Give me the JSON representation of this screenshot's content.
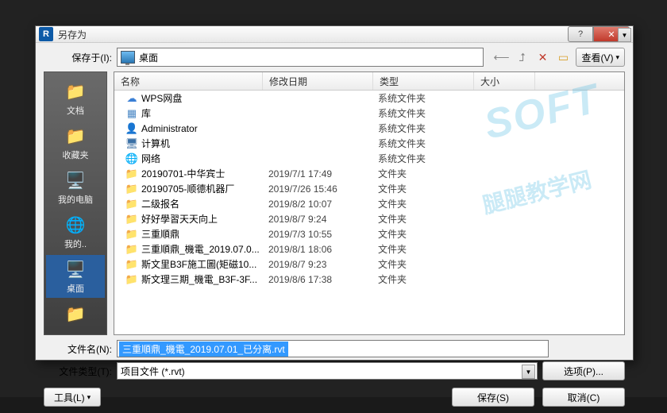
{
  "dialog": {
    "title": "另存为",
    "app_icon": "R"
  },
  "location": {
    "label": "保存于(I):",
    "value": "桌面",
    "view_btn": "查看(V)"
  },
  "sidebar": {
    "items": [
      {
        "label": "文档"
      },
      {
        "label": "收藏夹"
      },
      {
        "label": "我的电脑"
      },
      {
        "label": "我的.."
      },
      {
        "label": "桌面"
      },
      {
        "label": ""
      }
    ]
  },
  "columns": {
    "name": "名称",
    "date": "修改日期",
    "type": "类型",
    "size": "大小"
  },
  "rows": [
    {
      "icon": "cloud",
      "name": "WPS网盘",
      "date": "",
      "type": "系统文件夹"
    },
    {
      "icon": "lib",
      "name": "库",
      "date": "",
      "type": "系统文件夹"
    },
    {
      "icon": "user",
      "name": "Administrator",
      "date": "",
      "type": "系统文件夹"
    },
    {
      "icon": "pc",
      "name": "计算机",
      "date": "",
      "type": "系统文件夹"
    },
    {
      "icon": "net",
      "name": "网络",
      "date": "",
      "type": "系统文件夹"
    },
    {
      "icon": "folder",
      "name": "20190701-中华宾士",
      "date": "2019/7/1 17:49",
      "type": "文件夹"
    },
    {
      "icon": "folder",
      "name": "20190705-顺德机器厂",
      "date": "2019/7/26 15:46",
      "type": "文件夹"
    },
    {
      "icon": "folder",
      "name": "二级报名",
      "date": "2019/8/2 10:07",
      "type": "文件夹"
    },
    {
      "icon": "folder",
      "name": "好好學習天天向上",
      "date": "2019/8/7 9:24",
      "type": "文件夹"
    },
    {
      "icon": "folder",
      "name": "三重順鼎",
      "date": "2019/7/3 10:55",
      "type": "文件夹"
    },
    {
      "icon": "folder",
      "name": "三重順鼎_機電_2019.07.0...",
      "date": "2019/8/1 18:06",
      "type": "文件夹"
    },
    {
      "icon": "folder",
      "name": "斯文里B3F施工圖(矩磁10...",
      "date": "2019/8/7 9:23",
      "type": "文件夹"
    },
    {
      "icon": "folder",
      "name": "斯文理三期_機電_B3F-3F...",
      "date": "2019/8/6 17:38",
      "type": "文件夹"
    }
  ],
  "filename": {
    "label": "文件名(N):",
    "value": "三重順鼎_機電_2019.07.01_已分离.rvt"
  },
  "filetype": {
    "label": "文件类型(T):",
    "value": "项目文件 (*.rvt)"
  },
  "buttons": {
    "options": "选项(P)...",
    "tools": "工具(L)",
    "save": "保存(S)",
    "cancel": "取消(C)"
  },
  "watermark": {
    "big": "SOFT",
    "small": "腿腿教学网"
  }
}
